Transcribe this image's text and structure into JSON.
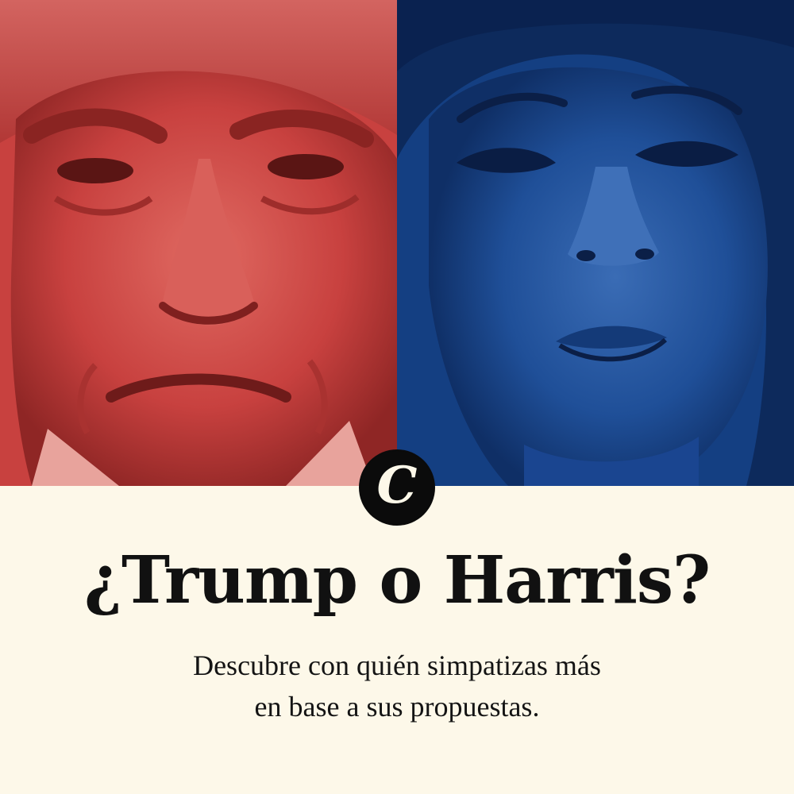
{
  "hero": {
    "left_panel": {
      "tint": "#c8413f",
      "subject": "trump-portrait"
    },
    "right_panel": {
      "tint": "#1b4a93",
      "subject": "harris-portrait"
    }
  },
  "logo": {
    "letter": "C",
    "icon": "comercio-c-logo"
  },
  "headline": "¿Trump o Harris?",
  "subtitle": {
    "line1": "Descubre con quién simpatizas más",
    "line2": "en base a sus propuestas."
  },
  "colors": {
    "background": "#fdf8e9",
    "text": "#111111",
    "red": "#c8413f",
    "blue": "#1b4a93"
  }
}
